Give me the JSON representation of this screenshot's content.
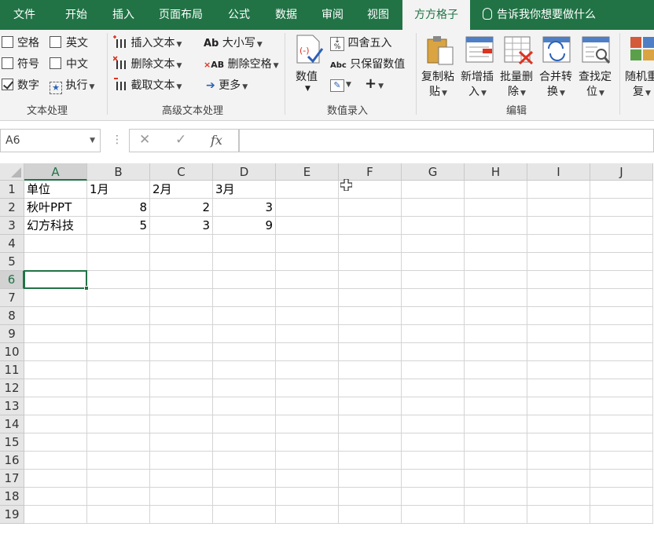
{
  "tabs": {
    "file": "文件",
    "home": "开始",
    "insert": "插入",
    "page_layout": "页面布局",
    "formulas": "公式",
    "data": "数据",
    "review": "审阅",
    "view": "视图",
    "addin": "方方格子",
    "tell_me": "告诉我你想要做什么"
  },
  "ribbon": {
    "text_group": {
      "label": "文本处理",
      "space": "空格",
      "symbol": "符号",
      "digit": "数字",
      "english": "英文",
      "chinese": "中文",
      "execute": "执行",
      "checked": {
        "space": false,
        "symbol": false,
        "digit": true,
        "english": false,
        "chinese": false
      }
    },
    "advanced_group": {
      "label": "高级文本处理",
      "insert_text": "插入文本",
      "delete_text": "删除文本",
      "extract_text": "截取文本",
      "case": "大小写",
      "delete_space": "删除空格",
      "more": "更多"
    },
    "number_group": {
      "label": "数值录入",
      "value": "数值",
      "round": "四舍五入",
      "keep_value": "只保留数值"
    },
    "edit_group": {
      "label": "编辑",
      "copy_paste_1": "复制粘",
      "copy_paste_2": "贴",
      "new_insert_1": "新增插",
      "new_insert_2": "入",
      "batch_delete_1": "批量删",
      "batch_delete_2": "除",
      "merge_convert_1": "合并转",
      "merge_convert_2": "换",
      "find_locate_1": "查找定",
      "find_locate_2": "位",
      "random_1": "随机重",
      "random_2": "复"
    }
  },
  "formula_bar": {
    "name_box": "A6",
    "cancel_icon": "✕",
    "enter_icon": "✓",
    "fx_label": "fx",
    "formula": ""
  },
  "sheet": {
    "columns": [
      "A",
      "B",
      "C",
      "D",
      "E",
      "F",
      "G",
      "H",
      "I",
      "J"
    ],
    "rows": [
      "1",
      "2",
      "3",
      "4",
      "5",
      "6",
      "7",
      "8",
      "9",
      "10",
      "11",
      "12",
      "13",
      "14",
      "15",
      "16",
      "17",
      "18",
      "19"
    ],
    "cells": {
      "A1": "单位",
      "B1": "1月",
      "C1": "2月",
      "D1": "3月",
      "A2": "秋叶PPT",
      "B2": "8",
      "C2": "2",
      "D2": "3",
      "A3": "幻方科技",
      "B3": "5",
      "C3": "3",
      "D3": "9"
    },
    "active_cell": "A6"
  },
  "colors": {
    "accent": "#217346"
  }
}
